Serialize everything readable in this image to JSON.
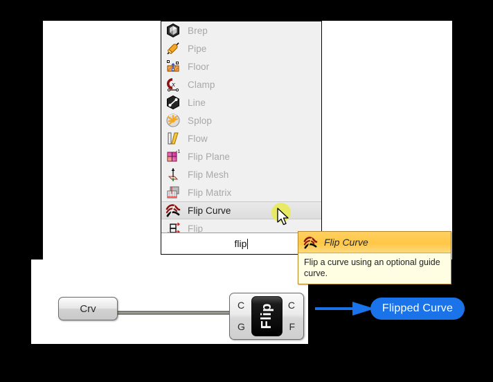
{
  "window": {
    "background_color": "#000000",
    "panel_color": "#ffffff"
  },
  "search_popup": {
    "name": "component-autocomplete-popup",
    "background_color": "#f0f0f0",
    "selected_index": 10,
    "items": [
      {
        "label": "Brep",
        "icon": "brep-icon",
        "selected": false
      },
      {
        "label": "Pipe",
        "icon": "pipe-icon",
        "selected": false
      },
      {
        "label": "Floor",
        "icon": "floor-icon",
        "selected": false
      },
      {
        "label": "Clamp",
        "icon": "clamp-icon",
        "selected": false
      },
      {
        "label": "Line",
        "icon": "line-icon",
        "selected": false
      },
      {
        "label": "Splop",
        "icon": "splop-icon",
        "selected": false
      },
      {
        "label": "Flow",
        "icon": "flow-icon",
        "selected": false
      },
      {
        "label": "Flip Plane",
        "icon": "flip-plane-icon",
        "selected": false
      },
      {
        "label": "Flip Mesh",
        "icon": "flip-mesh-icon",
        "selected": false
      },
      {
        "label": "Flip Matrix",
        "icon": "flip-matrix-icon",
        "selected": false
      },
      {
        "label": "Flip Curve",
        "icon": "flip-curve-icon",
        "selected": true
      },
      {
        "label": "Flip",
        "icon": "flip-icon",
        "selected": false
      }
    ],
    "search_field": {
      "value": "flip",
      "placeholder": "",
      "has_caret": true
    }
  },
  "tooltip": {
    "title": "Flip Curve",
    "description": "Flip a curve using an optional guide curve.",
    "icon": "flip-curve-icon",
    "header_color": "#ffc744",
    "body_color": "#fffde2"
  },
  "cursor": {
    "type": "arrow-pointer",
    "highlight_color": "#e8ea5a"
  },
  "graph": {
    "param_node": {
      "label": "Crv"
    },
    "component": {
      "label": "Flip",
      "inputs": [
        {
          "label": "C"
        },
        {
          "label": "G"
        }
      ],
      "outputs": [
        {
          "label": "C"
        },
        {
          "label": "F"
        }
      ]
    },
    "annotation": {
      "label": "Flipped Curve",
      "color": "#1a73e8",
      "arrow": "right-arrow"
    }
  }
}
